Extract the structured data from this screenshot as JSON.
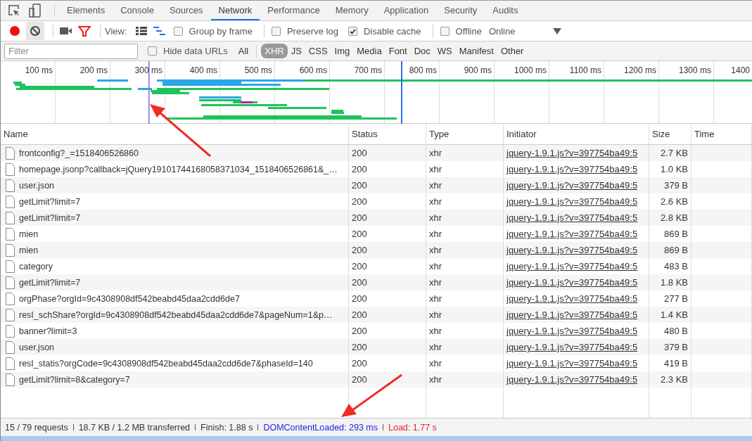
{
  "devtools_tabs": [
    {
      "label": "Elements",
      "selected": false
    },
    {
      "label": "Console",
      "selected": false
    },
    {
      "label": "Sources",
      "selected": false
    },
    {
      "label": "Network",
      "selected": true
    },
    {
      "label": "Performance",
      "selected": false
    },
    {
      "label": "Memory",
      "selected": false
    },
    {
      "label": "Application",
      "selected": false
    },
    {
      "label": "Security",
      "selected": false
    },
    {
      "label": "Audits",
      "selected": false
    }
  ],
  "toolbar": {
    "recording": true,
    "filter_active": true,
    "view_label": "View:",
    "options": [
      {
        "label": "Group by frame",
        "checked": false
      },
      {
        "label": "Preserve log",
        "checked": false
      },
      {
        "label": "Disable cache",
        "checked": true
      },
      {
        "label": "Offline",
        "checked": false
      }
    ],
    "throttling": "Online"
  },
  "filter_bar": {
    "placeholder": "Filter",
    "hide_data_urls": {
      "label": "Hide data URLs",
      "checked": false
    },
    "types": [
      {
        "label": "All",
        "selected": false
      },
      {
        "label": "XHR",
        "selected": true
      },
      {
        "label": "JS",
        "selected": false
      },
      {
        "label": "CSS",
        "selected": false
      },
      {
        "label": "Img",
        "selected": false
      },
      {
        "label": "Media",
        "selected": false
      },
      {
        "label": "Font",
        "selected": false
      },
      {
        "label": "Doc",
        "selected": false
      },
      {
        "label": "WS",
        "selected": false
      },
      {
        "label": "Manifest",
        "selected": false
      },
      {
        "label": "Other",
        "selected": false
      }
    ]
  },
  "overview": {
    "ticks": [
      "100 ms",
      "200 ms",
      "300 ms",
      "400 ms",
      "500 ms",
      "600 ms",
      "700 ms",
      "800 ms",
      "900 ms",
      "1000 ms",
      "1100 ms",
      "1200 ms",
      "1300 ms",
      "1400"
    ]
  },
  "table": {
    "columns": [
      "Name",
      "Status",
      "Type",
      "Initiator",
      "Size",
      "Time"
    ],
    "rows": [
      {
        "name": "frontconfig?_=1518406526860",
        "status": "200",
        "type": "xhr",
        "initiator": "jquery-1.9.1.js?v=397754ba49:5",
        "size": "2.7 KB"
      },
      {
        "name": "homepage.jsonp?callback=jQuery19101744168058371034_1518406526861&_…",
        "status": "200",
        "type": "xhr",
        "initiator": "jquery-1.9.1.js?v=397754ba49:5",
        "size": "1.0 KB"
      },
      {
        "name": "user.json",
        "status": "200",
        "type": "xhr",
        "initiator": "jquery-1.9.1.js?v=397754ba49:5",
        "size": "379 B"
      },
      {
        "name": "getLimit?limit=7",
        "status": "200",
        "type": "xhr",
        "initiator": "jquery-1.9.1.js?v=397754ba49:5",
        "size": "2.6 KB"
      },
      {
        "name": "getLimit?limit=7",
        "status": "200",
        "type": "xhr",
        "initiator": "jquery-1.9.1.js?v=397754ba49:5",
        "size": "2.8 KB"
      },
      {
        "name": "mien",
        "status": "200",
        "type": "xhr",
        "initiator": "jquery-1.9.1.js?v=397754ba49:5",
        "size": "869 B"
      },
      {
        "name": "mien",
        "status": "200",
        "type": "xhr",
        "initiator": "jquery-1.9.1.js?v=397754ba49:5",
        "size": "869 B"
      },
      {
        "name": "category",
        "status": "200",
        "type": "xhr",
        "initiator": "jquery-1.9.1.js?v=397754ba49:5",
        "size": "483 B"
      },
      {
        "name": "getLimit?limit=7",
        "status": "200",
        "type": "xhr",
        "initiator": "jquery-1.9.1.js?v=397754ba49:5",
        "size": "1.8 KB"
      },
      {
        "name": "orgPhase?orgId=9c4308908df542beabd45daa2cdd6de7",
        "status": "200",
        "type": "xhr",
        "initiator": "jquery-1.9.1.js?v=397754ba49:5",
        "size": "277 B"
      },
      {
        "name": "resI_schShare?orgId=9c4308908df542beabd45daa2cdd6de7&pageNum=1&p…",
        "status": "200",
        "type": "xhr",
        "initiator": "jquery-1.9.1.js?v=397754ba49:5",
        "size": "1.4 KB"
      },
      {
        "name": "banner?limit=3",
        "status": "200",
        "type": "xhr",
        "initiator": "jquery-1.9.1.js?v=397754ba49:5",
        "size": "480 B"
      },
      {
        "name": "user.json",
        "status": "200",
        "type": "xhr",
        "initiator": "jquery-1.9.1.js?v=397754ba49:5",
        "size": "379 B"
      },
      {
        "name": "resI_statis?orgCode=9c4308908df542beabd45daa2cdd6de7&phaseId=140",
        "status": "200",
        "type": "xhr",
        "initiator": "jquery-1.9.1.js?v=397754ba49:5",
        "size": "419 B"
      },
      {
        "name": "getLimit?limit=8&category=7",
        "status": "200",
        "type": "xhr",
        "initiator": "jquery-1.9.1.js?v=397754ba49:5",
        "size": "2.3 KB"
      }
    ]
  },
  "status_bar": [
    {
      "text": "15 / 79 requests",
      "kind": "plain"
    },
    {
      "text": "18.7 KB / 1.2 MB transferred",
      "kind": "plain"
    },
    {
      "text": "Finish: 1.88 s",
      "kind": "plain"
    },
    {
      "text": "DOMContentLoaded: 293 ms",
      "kind": "dom"
    },
    {
      "text": "Load: 1.77 s",
      "kind": "load"
    }
  ]
}
